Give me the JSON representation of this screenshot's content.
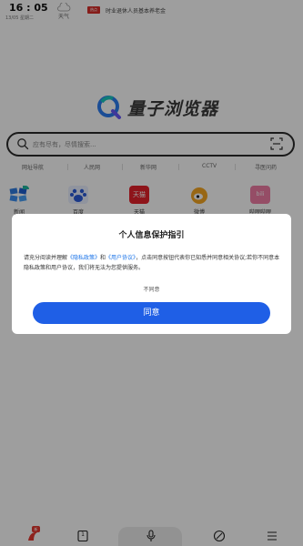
{
  "status": {
    "time": "16 : 05",
    "date": "13/05 星期二",
    "weather_label": "天气"
  },
  "news": {
    "badge": "热点",
    "headline": "时业退休人员基本养老金"
  },
  "brand": {
    "name": "量子浏览器"
  },
  "search": {
    "placeholder": "应有尽有，尽情搜索..."
  },
  "quick_links": [
    "网址导航",
    "人民网",
    "新华网",
    "CCTV",
    "寻医问药"
  ],
  "apps": [
    {
      "label": "新闻",
      "icon": "news-app-icon"
    },
    {
      "label": "百度",
      "icon": "baidu-app-icon"
    },
    {
      "label": "天猫",
      "icon": "tmall-app-icon"
    },
    {
      "label": "微博",
      "icon": "weibo-app-icon"
    },
    {
      "label": "哔哩哔哩",
      "icon": "bilibili-app-icon"
    }
  ],
  "dialog": {
    "title": "个人信息保护指引",
    "body_pre": "请充分阅读并理解",
    "privacy_link": "《隐私政策》",
    "and": "和",
    "user_link": "《用户协议》",
    "body_post": "，点击同意按钮代表你已知悉并同意相关协议;若你不同意本隐私政策和用户协议，我们将无法为您提供服务。",
    "decline": "不同意",
    "agree": "同意"
  },
  "nav": {
    "tab_count": "1",
    "home_badge": "新"
  },
  "colors": {
    "accent": "#1f5fe6",
    "link": "#1a73e8",
    "overlay": "rgba(0,0,0,0.38)"
  }
}
